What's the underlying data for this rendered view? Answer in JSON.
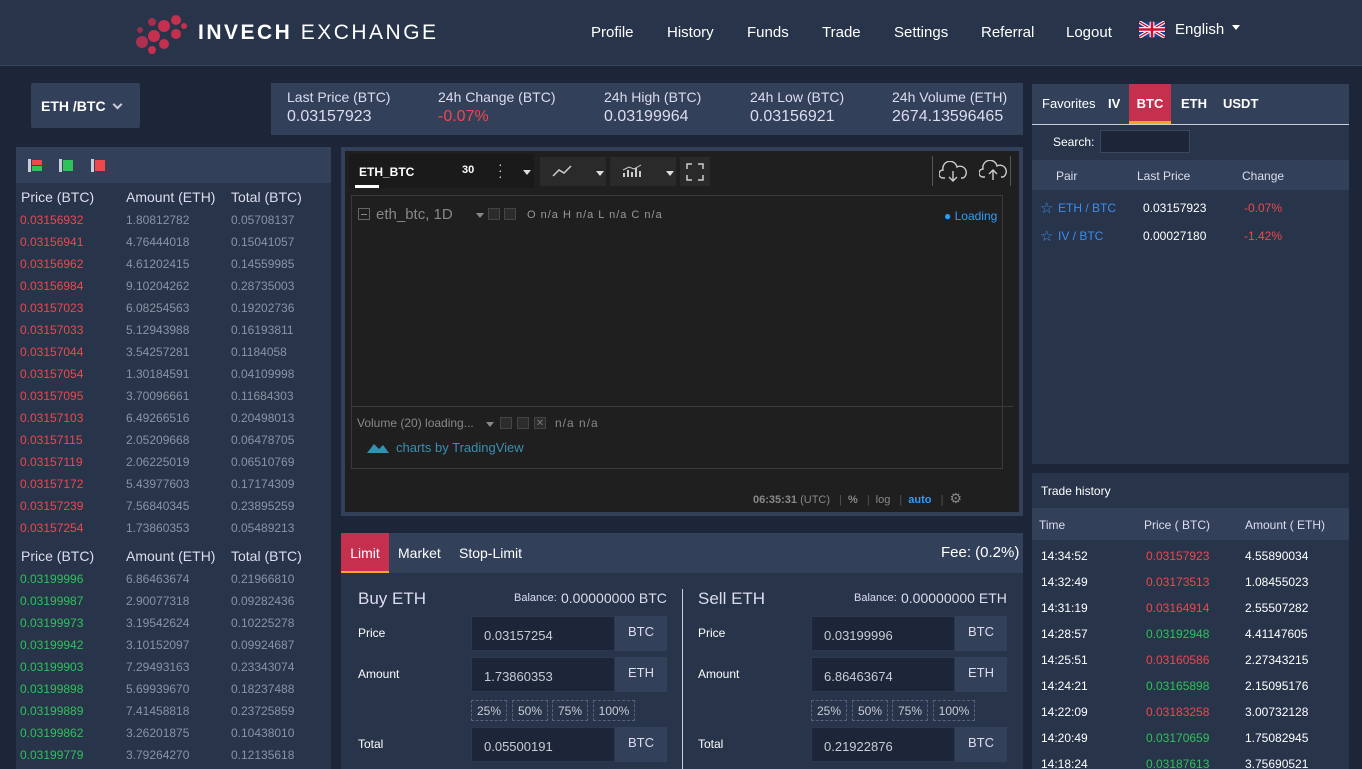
{
  "brand": {
    "bold": "INVECH",
    "rest": " EXCHANGE"
  },
  "nav": [
    "Profile",
    "History",
    "Funds",
    "Trade",
    "Settings",
    "Referral",
    "Logout"
  ],
  "language": "English",
  "pair_selector": "ETH /BTC",
  "stats": [
    {
      "label": "Last Price (BTC)",
      "value": "0.03157923"
    },
    {
      "label": "24h Change (BTC)",
      "value": "-0.07%"
    },
    {
      "label": "24h High (BTC)",
      "value": "0.03199964"
    },
    {
      "label": "24h Low (BTC)",
      "value": "0.03156921"
    },
    {
      "label": "24h Volume (ETH)",
      "value": "2674.13596465"
    }
  ],
  "orderbook": {
    "headers": [
      "Price (BTC)",
      "Amount (ETH)",
      "Total (BTC)"
    ],
    "asks": [
      [
        "0.03156932",
        "1.80812782",
        "0.05708137"
      ],
      [
        "0.03156941",
        "4.76444018",
        "0.15041057"
      ],
      [
        "0.03156962",
        "4.61202415",
        "0.14559985"
      ],
      [
        "0.03156984",
        "9.10204262",
        "0.28735003"
      ],
      [
        "0.03157023",
        "6.08254563",
        "0.19202736"
      ],
      [
        "0.03157033",
        "5.12943988",
        "0.16193811"
      ],
      [
        "0.03157044",
        "3.54257281",
        "0.1184058"
      ],
      [
        "0.03157054",
        "1.30184591",
        "0.04109998"
      ],
      [
        "0.03157095",
        "3.70096661",
        "0.11684303"
      ],
      [
        "0.03157103",
        "6.49266516",
        "0.20498013"
      ],
      [
        "0.03157115",
        "2.05209668",
        "0.06478705"
      ],
      [
        "0.03157119",
        "2.06225019",
        "0.06510769"
      ],
      [
        "0.03157172",
        "5.43977603",
        "0.17174309"
      ],
      [
        "0.03157239",
        "7.56840345",
        "0.23895259"
      ],
      [
        "0.03157254",
        "1.73860353",
        "0.05489213"
      ]
    ],
    "bids": [
      [
        "0.03199996",
        "6.86463674",
        "0.21966810"
      ],
      [
        "0.03199987",
        "2.90077318",
        "0.09282436"
      ],
      [
        "0.03199973",
        "3.19542624",
        "0.10225278"
      ],
      [
        "0.03199942",
        "3.10152097",
        "0.09924687"
      ],
      [
        "0.03199903",
        "7.29493163",
        "0.23343074"
      ],
      [
        "0.03199898",
        "5.69939670",
        "0.18237488"
      ],
      [
        "0.03199889",
        "7.41458818",
        "0.23725859"
      ],
      [
        "0.03199862",
        "3.26201875",
        "0.10438010"
      ],
      [
        "0.03199779",
        "3.79264270",
        "0.12135618"
      ]
    ]
  },
  "chart": {
    "symbol": "ETH_BTC",
    "interval": "30",
    "legend_symbol": "eth_btc, 1D",
    "ohlc": "O n/a  H n/a  L n/a  C n/a",
    "loading": "Loading",
    "volume": "Volume (20) loading...",
    "volume_vals": "n/a  n/a",
    "attribution": "charts by TradingView",
    "time": "06:35:31",
    "tz": "(UTC)",
    "pct": "%",
    "log": "log",
    "auto": "auto"
  },
  "order": {
    "tabs": [
      "Limit",
      "Market",
      "Stop-Limit"
    ],
    "fee": "Fee: (0.2%)",
    "buy": {
      "title": "Buy ETH",
      "balance_label": "Balance:",
      "balance": "0.00000000 BTC",
      "price_label": "Price",
      "price": "0.03157254",
      "price_unit": "BTC",
      "amount_label": "Amount",
      "amount": "1.73860353",
      "amount_unit": "ETH",
      "total_label": "Total",
      "total": "0.05500191",
      "total_unit": "BTC"
    },
    "sell": {
      "title": "Sell ETH",
      "balance_label": "Balance:",
      "balance": "0.00000000 ETH",
      "price_label": "Price",
      "price": "0.03199996",
      "price_unit": "BTC",
      "amount_label": "Amount",
      "amount": "6.86463674",
      "amount_unit": "ETH",
      "total_label": "Total",
      "total": "0.21922876",
      "total_unit": "BTC"
    },
    "percents": [
      "25%",
      "50%",
      "75%",
      "100%"
    ]
  },
  "markets": {
    "tabs": [
      "Favorites",
      "IV",
      "BTC",
      "ETH",
      "USDT"
    ],
    "active_tab": "BTC",
    "search_label": "Search:",
    "headers": [
      "Pair",
      "Last Price",
      "Change"
    ],
    "rows": [
      {
        "pair": "ETH / BTC",
        "price": "0.03157923",
        "change": "-0.07%"
      },
      {
        "pair": "IV / BTC",
        "price": "0.00027180",
        "change": "-1.42%"
      }
    ]
  },
  "trade_history": {
    "title": "Trade history",
    "headers": [
      "Time",
      "Price ( BTC)",
      "Amount ( ETH)"
    ],
    "rows": [
      {
        "time": "14:34:52",
        "price": "0.03157923",
        "amount": "4.55890034",
        "side": "sell"
      },
      {
        "time": "14:32:49",
        "price": "0.03173513",
        "amount": "1.08455023",
        "side": "sell"
      },
      {
        "time": "14:31:19",
        "price": "0.03164914",
        "amount": "2.55507282",
        "side": "sell"
      },
      {
        "time": "14:28:57",
        "price": "0.03192948",
        "amount": "4.41147605",
        "side": "buy"
      },
      {
        "time": "14:25:51",
        "price": "0.03160586",
        "amount": "2.27343215",
        "side": "sell"
      },
      {
        "time": "14:24:21",
        "price": "0.03165898",
        "amount": "2.15095176",
        "side": "buy"
      },
      {
        "time": "14:22:09",
        "price": "0.03183258",
        "amount": "3.00732128",
        "side": "sell"
      },
      {
        "time": "14:20:49",
        "price": "0.03170659",
        "amount": "1.75082945",
        "side": "buy"
      },
      {
        "time": "14:18:24",
        "price": "0.03187613",
        "amount": "3.75690521",
        "side": "buy"
      }
    ]
  },
  "colors": {
    "accent": "#c5304f",
    "up": "#2fc25b",
    "down": "#f0474d",
    "link": "#3a8ef0",
    "tab_underline": "#f5a623"
  }
}
